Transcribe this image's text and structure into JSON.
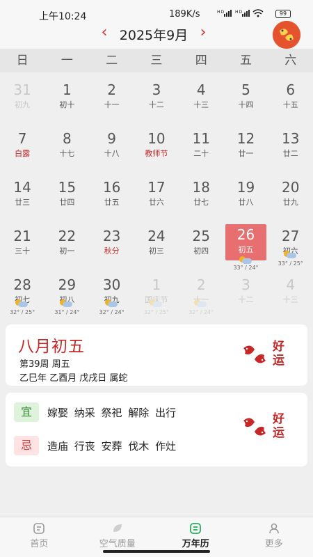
{
  "status_bar": {
    "time": "上午10:24",
    "network_speed": "189K/s",
    "signal_label": "HD",
    "battery": "99"
  },
  "header": {
    "month": "2025年9月",
    "prev_icon": "chevron-left-icon",
    "next_icon": "chevron-right-icon",
    "logo_icon": "koi-fish-icon",
    "accent_color": "#d32f2f"
  },
  "weekdays": [
    "日",
    "一",
    "二",
    "三",
    "四",
    "五",
    "六"
  ],
  "weeks": [
    [
      {
        "day": "31",
        "lunar": "初九",
        "dim": true
      },
      {
        "day": "1",
        "lunar": "初十"
      },
      {
        "day": "2",
        "lunar": "十一"
      },
      {
        "day": "3",
        "lunar": "十二"
      },
      {
        "day": "4",
        "lunar": "十三"
      },
      {
        "day": "5",
        "lunar": "十四"
      },
      {
        "day": "6",
        "lunar": "十五"
      }
    ],
    [
      {
        "day": "7",
        "lunar": "白露",
        "festival": true
      },
      {
        "day": "8",
        "lunar": "十七"
      },
      {
        "day": "9",
        "lunar": "十八"
      },
      {
        "day": "10",
        "lunar": "教师节",
        "festival": true
      },
      {
        "day": "11",
        "lunar": "二十"
      },
      {
        "day": "12",
        "lunar": "廿一"
      },
      {
        "day": "13",
        "lunar": "廿二"
      }
    ],
    [
      {
        "day": "14",
        "lunar": "廿三"
      },
      {
        "day": "15",
        "lunar": "廿四"
      },
      {
        "day": "16",
        "lunar": "廿五"
      },
      {
        "day": "17",
        "lunar": "廿六"
      },
      {
        "day": "18",
        "lunar": "廿七"
      },
      {
        "day": "19",
        "lunar": "廿八"
      },
      {
        "day": "20",
        "lunar": "廿九"
      }
    ],
    [
      {
        "day": "21",
        "lunar": "三十"
      },
      {
        "day": "22",
        "lunar": "初一"
      },
      {
        "day": "23",
        "lunar": "秋分",
        "festival": true
      },
      {
        "day": "24",
        "lunar": "初三"
      },
      {
        "day": "25",
        "lunar": "初四"
      },
      {
        "day": "26",
        "lunar": "初五",
        "selected": true,
        "weather": "33° / 24°"
      },
      {
        "day": "27",
        "lunar": "初六",
        "weather": "33° / 25°"
      }
    ],
    [
      {
        "day": "28",
        "lunar": "初七",
        "weather": "32° / 25°"
      },
      {
        "day": "29",
        "lunar": "初八",
        "weather": "31° / 24°"
      },
      {
        "day": "30",
        "lunar": "初九",
        "weather": "32° / 24°"
      },
      {
        "day": "1",
        "lunar": "国庆节",
        "dim": true,
        "weather": "32° / 25°"
      },
      {
        "day": "2",
        "lunar": "十一",
        "dim": true,
        "weather": "32° / 24°"
      },
      {
        "day": "3",
        "lunar": "十二",
        "dim": true
      },
      {
        "day": "4",
        "lunar": "十三",
        "dim": true
      }
    ]
  ],
  "info_card": {
    "lunar_date": "八月初五",
    "week_line": "第39周 周五",
    "ganzhi_line": "乙巳年 乙酉月 戊戌日 属蛇",
    "badge_text": "好运"
  },
  "yiji_card": {
    "yi_label": "宜",
    "yi_items": "嫁娶 纳采 祭祀 解除 出行",
    "ji_label": "忌",
    "ji_items": "造庙 行丧 安葬 伐木 作灶",
    "badge_text": "好运"
  },
  "tabs": [
    {
      "label": "首页",
      "icon": "home-icon"
    },
    {
      "label": "空气质量",
      "icon": "leaf-icon"
    },
    {
      "label": "万年历",
      "icon": "calendar-icon",
      "active": true
    },
    {
      "label": "更多",
      "icon": "person-icon"
    }
  ]
}
